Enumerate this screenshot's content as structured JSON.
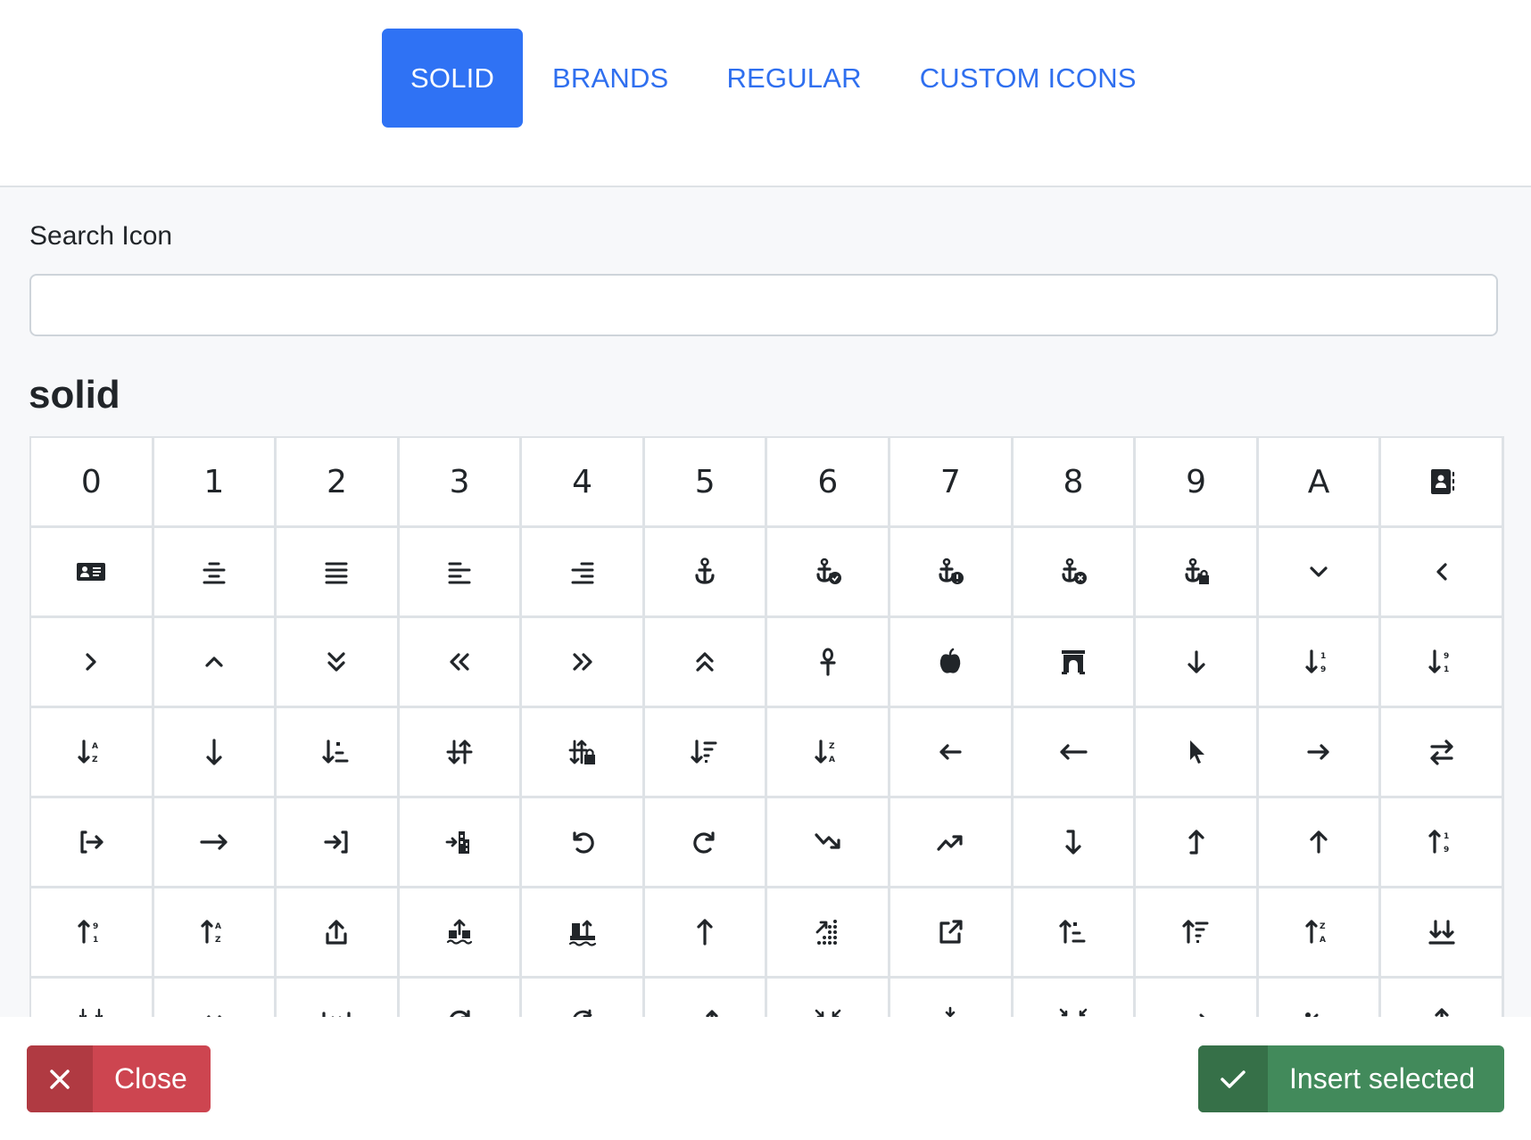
{
  "tabs": [
    {
      "label": "SOLID",
      "active": true
    },
    {
      "label": "BRANDS",
      "active": false
    },
    {
      "label": "REGULAR",
      "active": false
    },
    {
      "label": "CUSTOM ICONS",
      "active": false
    }
  ],
  "search": {
    "label": "Search Icon",
    "value": "",
    "placeholder": ""
  },
  "section_title": "solid",
  "icons": [
    {
      "name": "0",
      "text": "0"
    },
    {
      "name": "1",
      "text": "1"
    },
    {
      "name": "2",
      "text": "2"
    },
    {
      "name": "3",
      "text": "3"
    },
    {
      "name": "4",
      "text": "4"
    },
    {
      "name": "5",
      "text": "5"
    },
    {
      "name": "6",
      "text": "6"
    },
    {
      "name": "7",
      "text": "7"
    },
    {
      "name": "8",
      "text": "8"
    },
    {
      "name": "9",
      "text": "9"
    },
    {
      "name": "a",
      "text": "A"
    },
    {
      "name": "address-book"
    },
    {
      "name": "address-card"
    },
    {
      "name": "align-center"
    },
    {
      "name": "align-justify"
    },
    {
      "name": "align-left"
    },
    {
      "name": "align-right"
    },
    {
      "name": "anchor"
    },
    {
      "name": "anchor-circle-check"
    },
    {
      "name": "anchor-circle-exclamation"
    },
    {
      "name": "anchor-circle-xmark"
    },
    {
      "name": "anchor-lock"
    },
    {
      "name": "angle-down"
    },
    {
      "name": "angle-left"
    },
    {
      "name": "angle-right"
    },
    {
      "name": "angle-up"
    },
    {
      "name": "angles-down"
    },
    {
      "name": "angles-left"
    },
    {
      "name": "angles-right"
    },
    {
      "name": "angles-up"
    },
    {
      "name": "ankh"
    },
    {
      "name": "apple-whole"
    },
    {
      "name": "archway"
    },
    {
      "name": "arrow-down"
    },
    {
      "name": "arrow-down-1-9"
    },
    {
      "name": "arrow-down-9-1"
    },
    {
      "name": "arrow-down-a-z"
    },
    {
      "name": "arrow-down-long"
    },
    {
      "name": "arrow-down-short-wide"
    },
    {
      "name": "arrow-down-up-across-line"
    },
    {
      "name": "arrow-down-up-lock"
    },
    {
      "name": "arrow-down-wide-short"
    },
    {
      "name": "arrow-down-z-a"
    },
    {
      "name": "arrow-left"
    },
    {
      "name": "arrow-left-long"
    },
    {
      "name": "arrow-pointer"
    },
    {
      "name": "arrow-right"
    },
    {
      "name": "arrow-right-arrow-left"
    },
    {
      "name": "arrow-right-from-bracket"
    },
    {
      "name": "arrow-right-long"
    },
    {
      "name": "arrow-right-to-bracket"
    },
    {
      "name": "arrow-right-to-city"
    },
    {
      "name": "arrow-rotate-left"
    },
    {
      "name": "arrow-rotate-right"
    },
    {
      "name": "arrow-trend-down"
    },
    {
      "name": "arrow-trend-up"
    },
    {
      "name": "arrow-turn-down"
    },
    {
      "name": "arrow-turn-up"
    },
    {
      "name": "arrow-up"
    },
    {
      "name": "arrow-up-1-9"
    },
    {
      "name": "arrow-up-9-1"
    },
    {
      "name": "arrow-up-a-z"
    },
    {
      "name": "arrow-up-from-bracket"
    },
    {
      "name": "arrow-up-from-ground-water"
    },
    {
      "name": "arrow-up-from-water-pump"
    },
    {
      "name": "arrow-up-long"
    },
    {
      "name": "arrow-up-right-dots"
    },
    {
      "name": "arrow-up-right-from-square"
    },
    {
      "name": "arrow-up-short-wide"
    },
    {
      "name": "arrow-up-wide-short"
    },
    {
      "name": "arrow-up-z-a"
    },
    {
      "name": "arrows-down-to-line"
    },
    {
      "name": "arrows-down-to-people"
    },
    {
      "name": "arrows-left-right"
    },
    {
      "name": "arrows-left-right-to-line"
    },
    {
      "name": "arrows-rotate"
    },
    {
      "name": "arrows-spin"
    },
    {
      "name": "arrows-split-up-and-left"
    },
    {
      "name": "arrows-to-circle"
    },
    {
      "name": "arrows-to-dot"
    },
    {
      "name": "arrows-to-eye"
    },
    {
      "name": "arrows-turn-right"
    },
    {
      "name": "arrows-turn-to-dots"
    },
    {
      "name": "arrows-up-down"
    }
  ],
  "footer": {
    "close_label": "Close",
    "insert_label": "Insert selected"
  },
  "colors": {
    "accent": "#2f72f4",
    "close": "#cd4550",
    "insert": "#428a5b"
  }
}
